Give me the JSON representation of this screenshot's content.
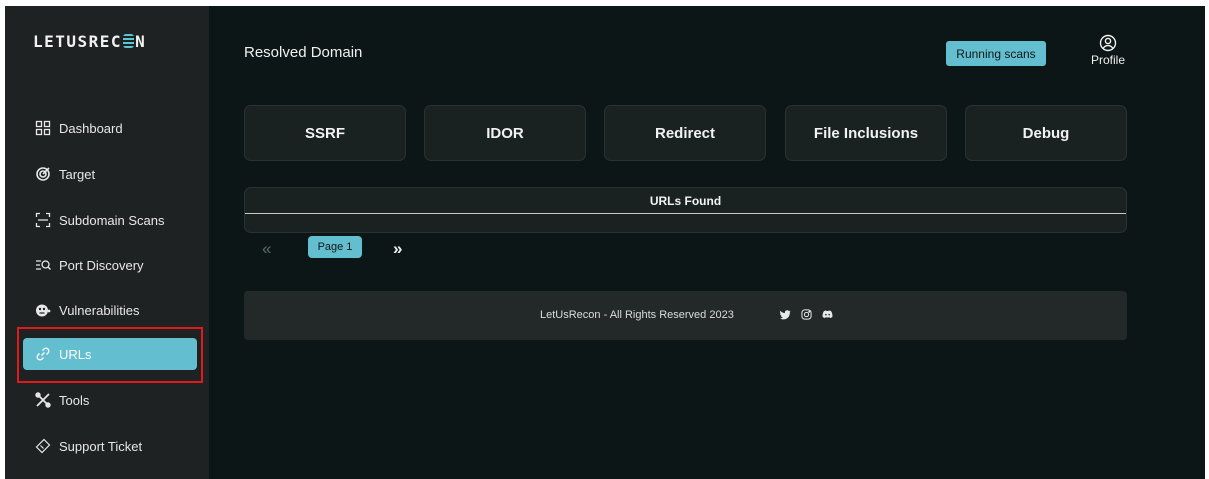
{
  "app": {
    "logo_text_a": "LETUSREC",
    "logo_text_b": "N"
  },
  "sidebar": {
    "items": [
      {
        "label": "Dashboard",
        "icon": "dashboard-icon"
      },
      {
        "label": "Target",
        "icon": "target-icon"
      },
      {
        "label": "Subdomain Scans",
        "icon": "subdomain-icon"
      },
      {
        "label": "Port Discovery",
        "icon": "port-discovery-icon"
      },
      {
        "label": "Vulnerabilities",
        "icon": "bug-icon"
      },
      {
        "label": "URLs",
        "icon": "link-icon",
        "active": true
      },
      {
        "label": "Tools",
        "icon": "tools-icon"
      },
      {
        "label": "Support Ticket",
        "icon": "ticket-icon"
      }
    ]
  },
  "header": {
    "title": "Resolved Domain",
    "running_scans_label": "Running scans",
    "profile_label": "Profile"
  },
  "categories": [
    "SSRF",
    "IDOR",
    "Redirect",
    "File Inclusions",
    "Debug"
  ],
  "urls_panel": {
    "title": "URLs Found"
  },
  "pagination": {
    "prev": "«",
    "page_label": "Page 1",
    "next": "»"
  },
  "footer": {
    "text": "LetUsRecon - All Rights Reserved 2023",
    "social": [
      "twitter-icon",
      "instagram-icon",
      "discord-icon"
    ]
  },
  "colors": {
    "accent": "#63bfcf",
    "background": "#0d1616",
    "sidebar": "#1f2222",
    "highlight": "#e01a1a"
  }
}
